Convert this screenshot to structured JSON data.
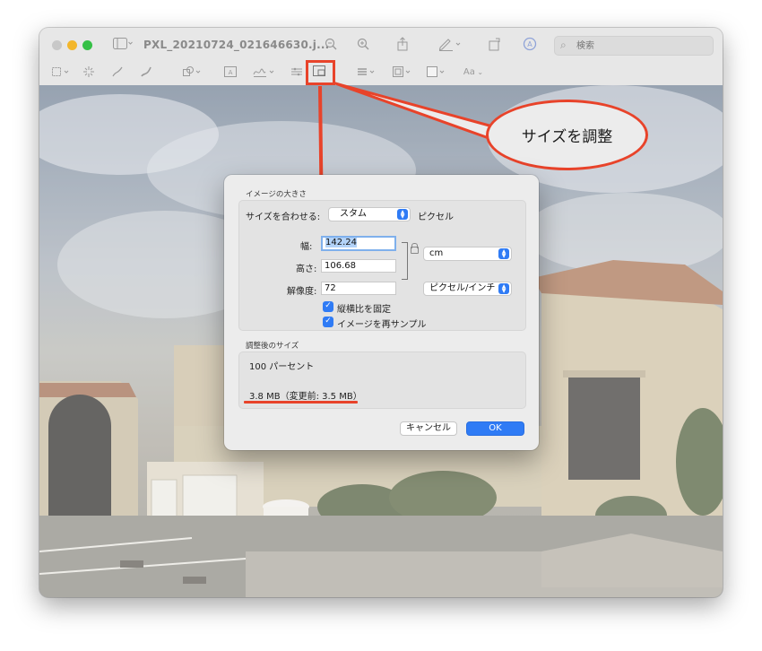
{
  "window": {
    "title": "PXL_20210724_021646630.j...",
    "search_placeholder": "検索"
  },
  "toolbar": {
    "sidebar_icon": "sidebar-icon",
    "zoom_out_icon": "zoom-out-icon",
    "zoom_in_icon": "zoom-in-icon",
    "share_icon": "share-icon",
    "markup_icon": "pen-icon",
    "rotate_icon": "rotate-icon",
    "annotate_icon": "markup-circle-icon",
    "markup_tools": [
      "selection-icon",
      "instant-alpha-icon",
      "sketch-icon",
      "draw-icon",
      "shapes-icon",
      "text-icon",
      "sign-icon",
      "adjust-color-icon",
      "adjust-size-icon",
      "shape-style-icon",
      "border-color-icon",
      "fill-color-icon",
      "text-style-icon"
    ],
    "text_style_label": "Aa"
  },
  "dialog": {
    "section_title": "イメージの大きさ",
    "fit_label": "サイズを合わせる:",
    "fit_value": "スタム",
    "fit_unit": "ピクセル",
    "width_label": "幅:",
    "width_value": "142.24",
    "height_label": "高さ:",
    "height_value": "106.68",
    "unit_value": "cm",
    "resolution_label": "解像度:",
    "resolution_value": "72",
    "resolution_unit": "ピクセル/インチ",
    "keep_ratio_label": "縦横比を固定",
    "resample_label": "イメージを再サンプル",
    "result_title": "調整後のサイズ",
    "percent_text": "100 パーセント",
    "size_text": "3.8 MB（変更前: 3.5 MB）",
    "cancel_label": "キャンセル",
    "ok_label": "OK"
  },
  "annotation": {
    "callout_text": "サイズを調整",
    "accent_color": "#e8432a"
  },
  "colors": {
    "primary_blue": "#2f7bf5"
  }
}
